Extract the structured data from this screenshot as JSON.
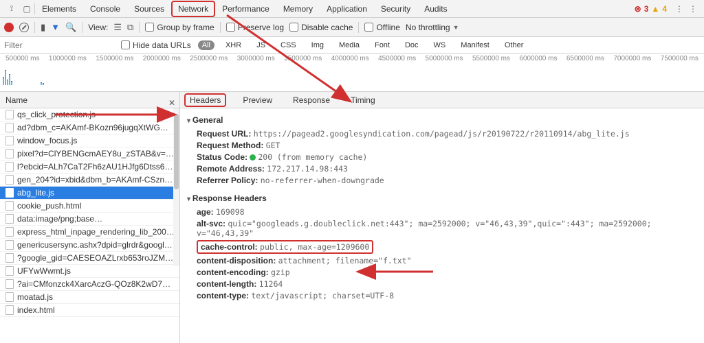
{
  "main_tabs": {
    "elements": "Elements",
    "console": "Console",
    "sources": "Sources",
    "network": "Network",
    "performance": "Performance",
    "memory": "Memory",
    "application": "Application",
    "security": "Security",
    "audits": "Audits"
  },
  "badges": {
    "errors": "3",
    "warnings": "4"
  },
  "toolbar": {
    "view": "View:",
    "group_by_frame": "Group by frame",
    "preserve_log": "Preserve log",
    "disable_cache": "Disable cache",
    "offline": "Offline",
    "throttling": "No throttling"
  },
  "filter": {
    "placeholder": "Filter",
    "hide_data_urls": "Hide data URLs",
    "all": "All",
    "xhr": "XHR",
    "js": "JS",
    "css": "CSS",
    "img": "Img",
    "media": "Media",
    "font": "Font",
    "doc": "Doc",
    "ws": "WS",
    "manifest": "Manifest",
    "other": "Other"
  },
  "timeline": [
    "500000 ms",
    "1000000 ms",
    "1500000 ms",
    "2000000 ms",
    "2500000 ms",
    "3000000 ms",
    "3500000 ms",
    "4000000 ms",
    "4500000 ms",
    "5000000 ms",
    "5500000 ms",
    "6000000 ms",
    "6500000 ms",
    "7000000 ms",
    "7500000 ms"
  ],
  "left": {
    "header": "Name"
  },
  "files": [
    "qs_click_protection.js",
    "ad?dbm_c=AKAmf-BKozn96jugqXtWG…",
    "window_focus.js",
    "pixel?d=ClYBENGcmAEY8u_zSTAB&v=…",
    "l?ebcid=ALh7CaT2Fh6zAU1HJfg6Dtss6…",
    "gen_204?id=xbid&dbm_b=AKAmf-CSzn…",
    "abg_lite.js",
    "cookie_push.html",
    "data:image/png;base…",
    "express_html_inpage_rendering_lib_200…",
    "genericusersync.ashx?dpid=glrdr&googl…",
    "?google_gid=CAESEOAZLrxb653roJZM…",
    "UFYwWwmt.js",
    "?ai=CMfonzck4XarcAczG-QOz8K2wD7…",
    "moatad.js",
    "index.html"
  ],
  "detail_tabs": {
    "headers": "Headers",
    "preview": "Preview",
    "response": "Response",
    "timing": "Timing"
  },
  "general": {
    "title": "General",
    "request_url_label": "Request URL:",
    "request_url": "https://pagead2.googlesyndication.com/pagead/js/r20190722/r20110914/abg_lite.js",
    "request_method_label": "Request Method:",
    "request_method": "GET",
    "status_code_label": "Status Code:",
    "status_code": "200",
    "status_extra": "(from memory cache)",
    "remote_address_label": "Remote Address:",
    "remote_address": "172.217.14.98:443",
    "referrer_policy_label": "Referrer Policy:",
    "referrer_policy": "no-referrer-when-downgrade"
  },
  "response_headers": {
    "title": "Response Headers",
    "age_label": "age:",
    "age": "169098",
    "alt_svc_label": "alt-svc:",
    "alt_svc": "quic=\"googleads.g.doubleclick.net:443\"; ma=2592000; v=\"46,43,39\",quic=\":443\"; ma=2592000; v=\"46,43,39\"",
    "cache_control_label": "cache-control:",
    "cache_control": "public, max-age=1209600",
    "content_disposition_label": "content-disposition:",
    "content_disposition": "attachment; filename=\"f.txt\"",
    "content_encoding_label": "content-encoding:",
    "content_encoding": "gzip",
    "content_length_label": "content-length:",
    "content_length": "11264",
    "content_type_label": "content-type:",
    "content_type": "text/javascript; charset=UTF-8"
  }
}
